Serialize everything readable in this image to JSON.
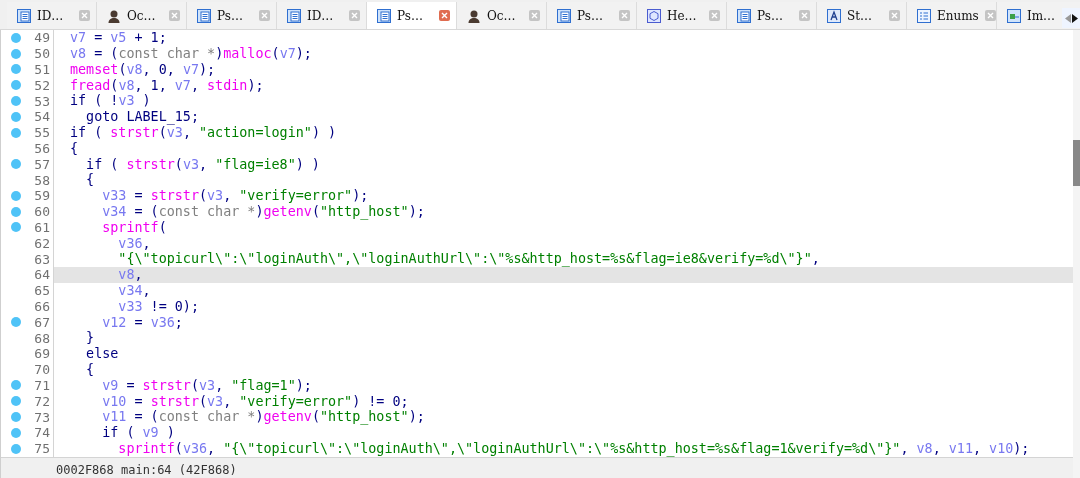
{
  "tabs": [
    {
      "label": "ID…",
      "kind": "view",
      "selected": false
    },
    {
      "label": "Oc…",
      "kind": "person",
      "selected": false
    },
    {
      "label": "Ps…",
      "kind": "view",
      "selected": false
    },
    {
      "label": "ID…",
      "kind": "view",
      "selected": false
    },
    {
      "label": "Ps…",
      "kind": "view",
      "selected": true
    },
    {
      "label": "Oc…",
      "kind": "person",
      "selected": false
    },
    {
      "label": "Ps…",
      "kind": "view",
      "selected": false
    },
    {
      "label": "He…",
      "kind": "hex",
      "selected": false
    },
    {
      "label": "Ps…",
      "kind": "view",
      "selected": false
    },
    {
      "label": "St…",
      "kind": "struct",
      "selected": false
    },
    {
      "label": "Enums",
      "kind": "enum",
      "selected": false
    },
    {
      "label": "Im…",
      "kind": "import",
      "selected": false
    }
  ],
  "code": {
    "lines": [
      {
        "number": "49",
        "breakpoint": true,
        "highlighted": false,
        "tokens": [
          {
            "kind": "var",
            "text": "v7"
          },
          {
            "kind": "plain",
            "text": " = "
          },
          {
            "kind": "var",
            "text": "v5"
          },
          {
            "kind": "plain",
            "text": " + 1;"
          }
        ]
      },
      {
        "number": "50",
        "breakpoint": true,
        "highlighted": false,
        "tokens": [
          {
            "kind": "var",
            "text": "v8"
          },
          {
            "kind": "plain",
            "text": " = ("
          },
          {
            "kind": "type",
            "text": "const char *"
          },
          {
            "kind": "plain",
            "text": ")"
          },
          {
            "kind": "func",
            "text": "malloc"
          },
          {
            "kind": "plain",
            "text": "("
          },
          {
            "kind": "var",
            "text": "v7"
          },
          {
            "kind": "plain",
            "text": ");"
          }
        ]
      },
      {
        "number": "51",
        "breakpoint": true,
        "highlighted": false,
        "tokens": [
          {
            "kind": "func",
            "text": "memset"
          },
          {
            "kind": "plain",
            "text": "("
          },
          {
            "kind": "var",
            "text": "v8"
          },
          {
            "kind": "plain",
            "text": ", 0, "
          },
          {
            "kind": "var",
            "text": "v7"
          },
          {
            "kind": "plain",
            "text": ");"
          }
        ]
      },
      {
        "number": "52",
        "breakpoint": true,
        "highlighted": false,
        "tokens": [
          {
            "kind": "func",
            "text": "fread"
          },
          {
            "kind": "plain",
            "text": "("
          },
          {
            "kind": "var",
            "text": "v8"
          },
          {
            "kind": "plain",
            "text": ", 1, "
          },
          {
            "kind": "var",
            "text": "v7"
          },
          {
            "kind": "plain",
            "text": ", "
          },
          {
            "kind": "func",
            "text": "stdin"
          },
          {
            "kind": "plain",
            "text": ");"
          }
        ]
      },
      {
        "number": "53",
        "breakpoint": true,
        "highlighted": false,
        "tokens": [
          {
            "kind": "plain",
            "text": "if ( !"
          },
          {
            "kind": "var",
            "text": "v3"
          },
          {
            "kind": "plain",
            "text": " )"
          }
        ]
      },
      {
        "number": "54",
        "breakpoint": true,
        "highlighted": false,
        "tokens": [
          {
            "kind": "plain",
            "text": "  goto LABEL_15;"
          }
        ]
      },
      {
        "number": "55",
        "breakpoint": true,
        "highlighted": false,
        "tokens": [
          {
            "kind": "plain",
            "text": "if ( "
          },
          {
            "kind": "func",
            "text": "strstr"
          },
          {
            "kind": "plain",
            "text": "("
          },
          {
            "kind": "var",
            "text": "v3"
          },
          {
            "kind": "plain",
            "text": ", "
          },
          {
            "kind": "str",
            "text": "\"action=login\""
          },
          {
            "kind": "plain",
            "text": ") )"
          }
        ]
      },
      {
        "number": "56",
        "breakpoint": false,
        "highlighted": false,
        "tokens": [
          {
            "kind": "plain",
            "text": "{"
          }
        ]
      },
      {
        "number": "57",
        "breakpoint": true,
        "highlighted": false,
        "tokens": [
          {
            "kind": "plain",
            "text": "  if ( "
          },
          {
            "kind": "func",
            "text": "strstr"
          },
          {
            "kind": "plain",
            "text": "("
          },
          {
            "kind": "var",
            "text": "v3"
          },
          {
            "kind": "plain",
            "text": ", "
          },
          {
            "kind": "str",
            "text": "\"flag=ie8\""
          },
          {
            "kind": "plain",
            "text": ") )"
          }
        ]
      },
      {
        "number": "58",
        "breakpoint": false,
        "highlighted": false,
        "tokens": [
          {
            "kind": "plain",
            "text": "  {"
          }
        ]
      },
      {
        "number": "59",
        "breakpoint": true,
        "highlighted": false,
        "tokens": [
          {
            "kind": "var",
            "text": "    v33"
          },
          {
            "kind": "plain",
            "text": " = "
          },
          {
            "kind": "func",
            "text": "strstr"
          },
          {
            "kind": "plain",
            "text": "("
          },
          {
            "kind": "var",
            "text": "v3"
          },
          {
            "kind": "plain",
            "text": ", "
          },
          {
            "kind": "str",
            "text": "\"verify=error\""
          },
          {
            "kind": "plain",
            "text": ");"
          }
        ]
      },
      {
        "number": "60",
        "breakpoint": true,
        "highlighted": false,
        "tokens": [
          {
            "kind": "var",
            "text": "    v34"
          },
          {
            "kind": "plain",
            "text": " = ("
          },
          {
            "kind": "type",
            "text": "const char *"
          },
          {
            "kind": "plain",
            "text": ")"
          },
          {
            "kind": "func",
            "text": "getenv"
          },
          {
            "kind": "plain",
            "text": "("
          },
          {
            "kind": "str",
            "text": "\"http_host\""
          },
          {
            "kind": "plain",
            "text": ");"
          }
        ]
      },
      {
        "number": "61",
        "breakpoint": true,
        "highlighted": false,
        "tokens": [
          {
            "kind": "func",
            "text": "    sprintf"
          },
          {
            "kind": "plain",
            "text": "("
          }
        ]
      },
      {
        "number": "62",
        "breakpoint": false,
        "highlighted": false,
        "tokens": [
          {
            "kind": "var",
            "text": "      v36"
          },
          {
            "kind": "plain",
            "text": ","
          }
        ]
      },
      {
        "number": "63",
        "breakpoint": false,
        "highlighted": false,
        "tokens": [
          {
            "kind": "str",
            "text": "      \"{\\\"topicurl\\\":\\\"loginAuth\\\",\\\"loginAuthUrl\\\":\\\"%s&http_host=%s&flag=ie8&verify=%d\\\"}\""
          },
          {
            "kind": "plain",
            "text": ","
          }
        ]
      },
      {
        "number": "64",
        "breakpoint": false,
        "highlighted": true,
        "tokens": [
          {
            "kind": "var",
            "text": "      v8"
          },
          {
            "kind": "plain",
            "text": ","
          }
        ]
      },
      {
        "number": "65",
        "breakpoint": false,
        "highlighted": false,
        "tokens": [
          {
            "kind": "var",
            "text": "      v34"
          },
          {
            "kind": "plain",
            "text": ","
          }
        ]
      },
      {
        "number": "66",
        "breakpoint": false,
        "highlighted": false,
        "tokens": [
          {
            "kind": "var",
            "text": "      v33"
          },
          {
            "kind": "plain",
            "text": " != 0);"
          }
        ]
      },
      {
        "number": "67",
        "breakpoint": true,
        "highlighted": false,
        "tokens": [
          {
            "kind": "var",
            "text": "    v12"
          },
          {
            "kind": "plain",
            "text": " = "
          },
          {
            "kind": "var",
            "text": "v36"
          },
          {
            "kind": "plain",
            "text": ";"
          }
        ]
      },
      {
        "number": "68",
        "breakpoint": false,
        "highlighted": false,
        "tokens": [
          {
            "kind": "plain",
            "text": "  }"
          }
        ]
      },
      {
        "number": "69",
        "breakpoint": false,
        "highlighted": false,
        "tokens": [
          {
            "kind": "plain",
            "text": "  else"
          }
        ]
      },
      {
        "number": "70",
        "breakpoint": false,
        "highlighted": false,
        "tokens": [
          {
            "kind": "plain",
            "text": "  {"
          }
        ]
      },
      {
        "number": "71",
        "breakpoint": true,
        "highlighted": false,
        "tokens": [
          {
            "kind": "var",
            "text": "    v9"
          },
          {
            "kind": "plain",
            "text": " = "
          },
          {
            "kind": "func",
            "text": "strstr"
          },
          {
            "kind": "plain",
            "text": "("
          },
          {
            "kind": "var",
            "text": "v3"
          },
          {
            "kind": "plain",
            "text": ", "
          },
          {
            "kind": "str",
            "text": "\"flag=1\""
          },
          {
            "kind": "plain",
            "text": ");"
          }
        ]
      },
      {
        "number": "72",
        "breakpoint": true,
        "highlighted": false,
        "tokens": [
          {
            "kind": "var",
            "text": "    v10"
          },
          {
            "kind": "plain",
            "text": " = "
          },
          {
            "kind": "func",
            "text": "strstr"
          },
          {
            "kind": "plain",
            "text": "("
          },
          {
            "kind": "var",
            "text": "v3"
          },
          {
            "kind": "plain",
            "text": ", "
          },
          {
            "kind": "str",
            "text": "\"verify=error\""
          },
          {
            "kind": "plain",
            "text": ") != 0;"
          }
        ]
      },
      {
        "number": "73",
        "breakpoint": true,
        "highlighted": false,
        "tokens": [
          {
            "kind": "var",
            "text": "    v11"
          },
          {
            "kind": "plain",
            "text": " = ("
          },
          {
            "kind": "type",
            "text": "const char *"
          },
          {
            "kind": "plain",
            "text": ")"
          },
          {
            "kind": "func",
            "text": "getenv"
          },
          {
            "kind": "plain",
            "text": "("
          },
          {
            "kind": "str",
            "text": "\"http_host\""
          },
          {
            "kind": "plain",
            "text": ");"
          }
        ]
      },
      {
        "number": "74",
        "breakpoint": true,
        "highlighted": false,
        "tokens": [
          {
            "kind": "plain",
            "text": "    if ( "
          },
          {
            "kind": "var",
            "text": "v9"
          },
          {
            "kind": "plain",
            "text": " )"
          }
        ]
      },
      {
        "number": "75",
        "breakpoint": true,
        "highlighted": false,
        "tokens": [
          {
            "kind": "func",
            "text": "      sprintf"
          },
          {
            "kind": "plain",
            "text": "("
          },
          {
            "kind": "var",
            "text": "v36"
          },
          {
            "kind": "plain",
            "text": ", "
          },
          {
            "kind": "str",
            "text": "\"{\\\"topicurl\\\":\\\"loginAuth\\\",\\\"loginAuthUrl\\\":\\\"%s&http_host=%s&flag=1&verify=%d\\\"}\""
          },
          {
            "kind": "plain",
            "text": ", "
          },
          {
            "kind": "var",
            "text": "v8"
          },
          {
            "kind": "plain",
            "text": ", "
          },
          {
            "kind": "var",
            "text": "v11"
          },
          {
            "kind": "plain",
            "text": ", "
          },
          {
            "kind": "var",
            "text": "v10"
          },
          {
            "kind": "plain",
            "text": ");"
          }
        ]
      }
    ]
  },
  "status_bar": {
    "text": "0002F868 main:64 (42F868)"
  }
}
